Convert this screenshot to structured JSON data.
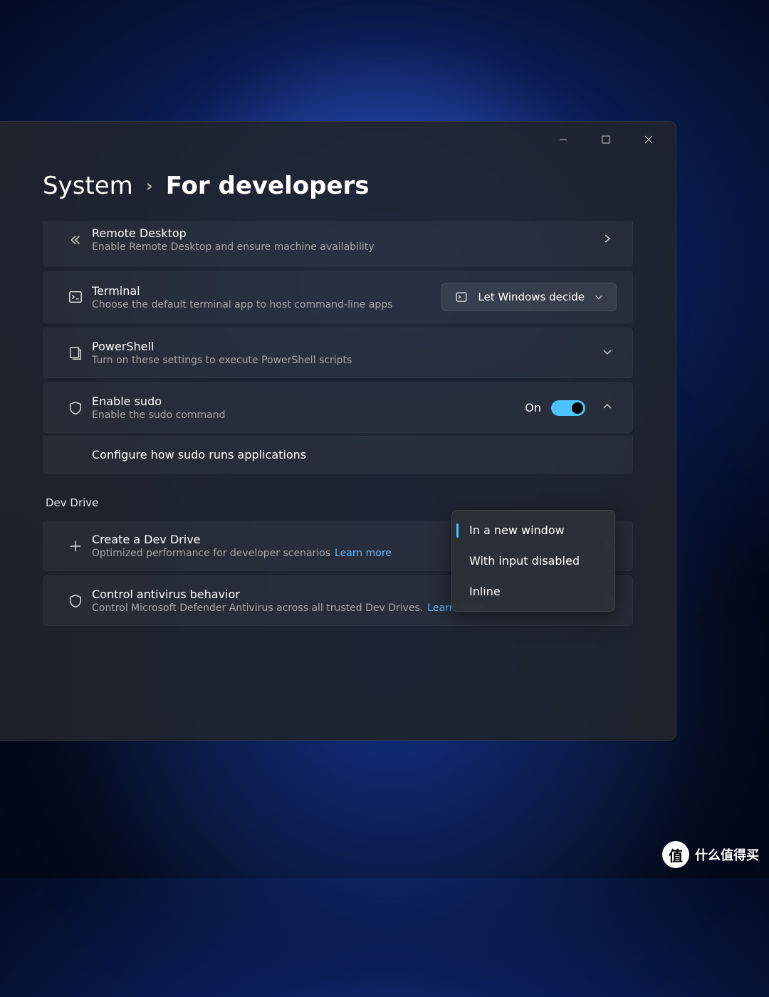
{
  "breadcrumb": {
    "parent": "System",
    "current": "For developers"
  },
  "window_controls": {
    "min": "minimize",
    "max": "maximize",
    "close": "close"
  },
  "rows": {
    "remote": {
      "title": "Remote Desktop",
      "desc": "Enable Remote Desktop and ensure machine availability"
    },
    "terminal": {
      "title": "Terminal",
      "desc": "Choose the default terminal app to host command-line apps",
      "dropdown": "Let Windows decide"
    },
    "powershell": {
      "title": "PowerShell",
      "desc": "Turn on these settings to execute PowerShell scripts"
    },
    "sudo": {
      "title": "Enable sudo",
      "desc": "Enable the sudo command",
      "state": "On"
    },
    "sudo_config": {
      "label": "Configure how sudo runs applications"
    },
    "devdrive": {
      "title": "Create a Dev Drive",
      "desc": "Optimized performance for developer scenarios",
      "link": "Learn more"
    },
    "antivirus": {
      "title": "Control antivirus behavior",
      "desc": "Control Microsoft Defender Antivirus across all trusted Dev Drives.",
      "link": "Learn more"
    }
  },
  "section": {
    "devdrive": "Dev Drive"
  },
  "menu": {
    "items": [
      "In a new window",
      "With input disabled",
      "Inline"
    ],
    "selected": 0
  },
  "watermark": {
    "badge": "值",
    "text": "什么值得买"
  }
}
